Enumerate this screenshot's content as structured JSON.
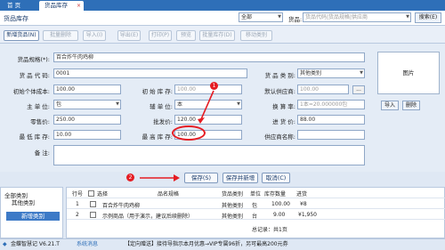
{
  "tabs": {
    "home": "首 页",
    "active": "货品库存",
    "close": "×"
  },
  "header": {
    "title": "货品库存",
    "scope_select": "全部",
    "filter_label": "货品:",
    "search_placeholder": "货品代码|货品规格|供应商",
    "search_btn": "搜索(E)"
  },
  "toolbar": {
    "new": "新增货品(N)",
    "save": "批量删除",
    "import": "导入(I)",
    "export": "导出(E)",
    "print": "打印(P)",
    "preview": "预览",
    "batch": "批量库存(D)",
    "move": "移动类别"
  },
  "form": {
    "spec_label": "货品规格(*):",
    "spec_value": "百合炸牛肉鸡柳",
    "code_label": "货 品 代 码:",
    "code_value": "0001",
    "category_label": "货 品 类 别:",
    "category_value": "其他类别",
    "initqty_label": "初始个体成本:",
    "initqty_value": "100.00",
    "initstock_label": "初 始 库 存:",
    "initstock_value": "100.00",
    "supplier_label": "默认供应商:",
    "supplier_value": "100.00",
    "unit_label": "主  单  位:",
    "unit_value": "包",
    "aux_label": "辅 单 位:",
    "aux_value": "本",
    "conv_label": "换 算 率:",
    "conv_value": "1本=20.000000包",
    "retail_label": "零售价:",
    "retail_value": "250.00",
    "wholesale_label": "批发价:",
    "wholesale_value": "120.00",
    "purchase_label": "进  货  价:",
    "purchase_value": "88.00",
    "min_label": "最 低 库 存:",
    "min_value": "10.00",
    "max_label": "最 高 库 存:",
    "max_value": "100.00",
    "vendor_label": "供应商名称:",
    "vendor_value": "",
    "remark_label": "备     注:",
    "image_label": "图片",
    "import_btn": "导入",
    "delete_btn": "删除",
    "dots": "..."
  },
  "actions": {
    "save": "保存(S)",
    "save_new": "保存并新增",
    "cancel": "取消(C)"
  },
  "annotations": {
    "one": "1",
    "two": "2"
  },
  "left_panel": {
    "all": "全部类别",
    "other": "其他类别",
    "new_btn": "新增类别"
  },
  "grid": {
    "headers": [
      "行号",
      "选择",
      "品名规格",
      "货品类别",
      "单位",
      "库存数量",
      "进货"
    ],
    "rows": [
      {
        "no": "1",
        "name": "百合炸牛肉鸡柳",
        "category": "其他类别",
        "unit": "包",
        "qty": "100.00",
        "price": "¥8"
      },
      {
        "no": "2",
        "name": "示例商品（用于演示，建议后续删除）",
        "category": "其他类别",
        "unit": "台",
        "qty": "9.00",
        "price": "¥1,950"
      }
    ],
    "footer": "总记录：共1页"
  },
  "status": {
    "app": "金蝶智慧记 V6.21.T",
    "state": "系统消息",
    "message": "【定向赠送】接待导指示本月优惠→VIP专属96折，另可最高200元券"
  },
  "colors": {
    "brand": "#2e6fb8",
    "annotation": "#e51c23"
  }
}
